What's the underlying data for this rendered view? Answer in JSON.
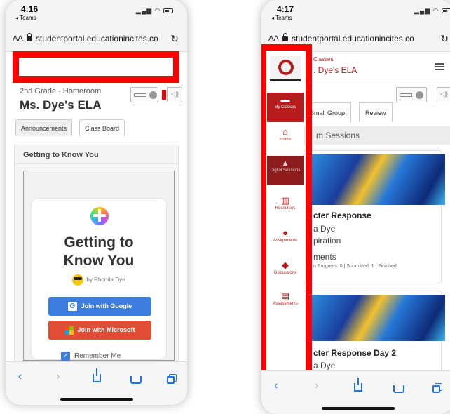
{
  "left_phone": {
    "status": {
      "time": "4:16",
      "back_app": "◂ Teams"
    },
    "url": {
      "aa": "AA",
      "domain": "studentportal.educationincites.co"
    },
    "course": {
      "subtitle": "2nd Grade - Homeroom",
      "title": "Ms. Dye's ELA"
    },
    "tabs": [
      {
        "label": "Announcements"
      },
      {
        "label": "Class Board"
      }
    ],
    "panel_title": "Getting to Know You",
    "card": {
      "title_line1": "Getting to",
      "title_line2": "Know You",
      "author": "by Rhonda Dye",
      "google_button": "Join with Google",
      "microsoft_button": "Join with Microsoft",
      "remember": "Remember Me"
    }
  },
  "right_phone": {
    "status": {
      "time": "4:17",
      "back_app": "◂ Teams"
    },
    "url": {
      "aa": "AA",
      "domain": "studentportal.educationincites.co"
    },
    "header": {
      "crumb": "Classes",
      "title": ". Dye's ELA"
    },
    "tabs": [
      {
        "label": "Small Group"
      },
      {
        "label": "Review"
      }
    ],
    "section_title": "m Sessions",
    "cards": [
      {
        "title": "cter Response",
        "line1": "a Dye",
        "line2": "piration",
        "line3": "ments",
        "stats": "n Progress: 0 | Submitted: 1 | Finished:"
      },
      {
        "title": "cter Response Day 2",
        "line1": "a Dye"
      }
    ],
    "sidebar": [
      {
        "label": "My Classes",
        "icon": "monitor-icon"
      },
      {
        "label": "Home",
        "icon": "house-icon"
      },
      {
        "label": "Digital Sessions",
        "icon": "graduation-cap-icon"
      },
      {
        "label": "Resources",
        "icon": "books-icon"
      },
      {
        "label": "Assignments",
        "icon": "head-gear-icon"
      },
      {
        "label": "Discussions",
        "icon": "chat-bubbles-icon"
      },
      {
        "label": "Assessments",
        "icon": "clipboard-icon"
      }
    ]
  },
  "colors": {
    "highlight": "#ff0000",
    "brand_red": "#b71c1c",
    "google_blue": "#3d7de0",
    "microsoft_red": "#e14c35"
  }
}
